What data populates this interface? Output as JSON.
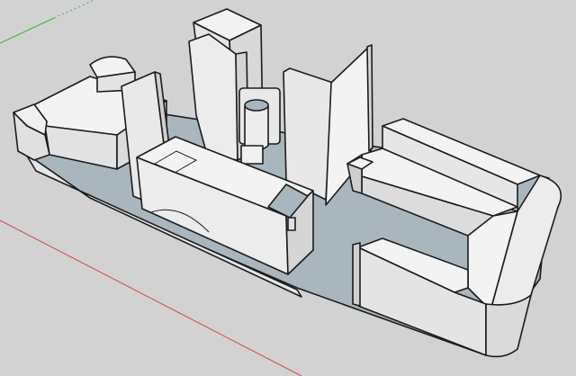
{
  "colors": {
    "sky_ground": "#d2d2d2",
    "floor": "#a9b6bd",
    "face_light": "#f3f3f3",
    "face_mid": "#e4e4e4",
    "face_shade": "#cdcdcd",
    "edge": "#1c1c1c",
    "axis_red": "#d24a4a",
    "axis_green": "#3fb03f"
  },
  "icons": {
    "origin_axes": "axes-icon"
  }
}
